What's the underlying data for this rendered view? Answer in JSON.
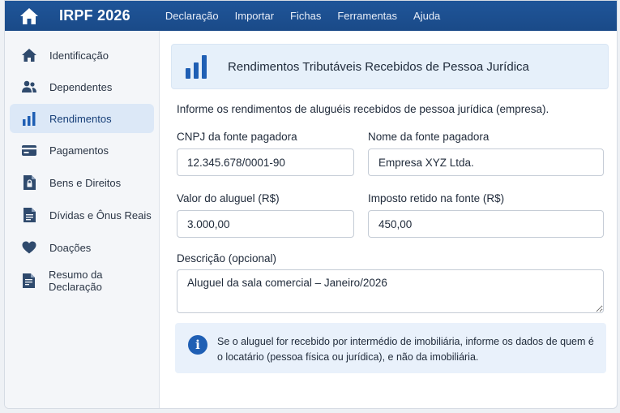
{
  "app": {
    "title": "IRPF 2026"
  },
  "menu": [
    "Declaração",
    "Importar",
    "Fichas",
    "Ferramentas",
    "Ajuda"
  ],
  "sidebar": {
    "items": [
      {
        "label": "Identificação",
        "icon": "home-icon"
      },
      {
        "label": "Dependentes",
        "icon": "people-icon"
      },
      {
        "label": "Rendimentos",
        "icon": "bar-chart-icon",
        "active": true
      },
      {
        "label": "Pagamentos",
        "icon": "card-icon"
      },
      {
        "label": "Bens e Direitos",
        "icon": "document-lock-icon"
      },
      {
        "label": "Dívidas e Ônus Reais",
        "icon": "document-icon"
      },
      {
        "label": "Doações",
        "icon": "heart-icon"
      },
      {
        "label": "Resumo da Declaração",
        "icon": "summary-document-icon"
      }
    ]
  },
  "section": {
    "title": "Rendimentos Tributáveis Recebidos de Pessoa Jurídica",
    "intro": "Informe os rendimentos de aluguéis recebidos de pessoa jurídica (empresa)."
  },
  "form": {
    "cnpj": {
      "label": "CNPJ da fonte pagadora",
      "value": "12.345.678/0001-90"
    },
    "nome": {
      "label": "Nome da fonte pagadora",
      "value": "Empresa XYZ Ltda."
    },
    "valor": {
      "label": "Valor do aluguel (R$)",
      "value": "3.000,00"
    },
    "imposto": {
      "label": "Imposto retido na fonte (R$)",
      "value": "450,00"
    },
    "descricao": {
      "label": "Descrição (opcional)",
      "value": "Aluguel da sala comercial – Janeiro/2026"
    }
  },
  "info": {
    "text": "Se o aluguel for recebido por intermédio de imobiliária, informe os dados de quem é o locatário (pessoa física ou jurídica), e não da imobiliária."
  },
  "colors": {
    "topbar": "#1f5599",
    "accent": "#1f5fb4",
    "active_bg": "#dce8f7"
  }
}
